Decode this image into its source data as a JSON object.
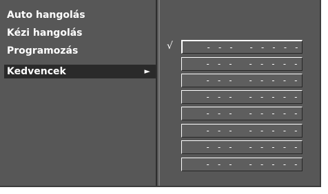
{
  "menu": {
    "items": [
      {
        "label": "Auto hangolás"
      },
      {
        "label": "Kézi hangolás"
      },
      {
        "label": "Programozás"
      },
      {
        "label": "Kedvencek",
        "arrow": "►"
      }
    ]
  },
  "favorites": {
    "check_mark": "√",
    "slots": [
      {
        "number": "- - -",
        "name": "- - - - -"
      },
      {
        "number": "- - -",
        "name": "- - - - -"
      },
      {
        "number": "- - -",
        "name": "- - - - -"
      },
      {
        "number": "- - -",
        "name": "- - - - -"
      },
      {
        "number": "- - -",
        "name": "- - - - -"
      },
      {
        "number": "- - -",
        "name": "- - - - -"
      },
      {
        "number": "- - -",
        "name": "- - - - -"
      },
      {
        "number": "- - -",
        "name": "- - - - -"
      }
    ]
  }
}
